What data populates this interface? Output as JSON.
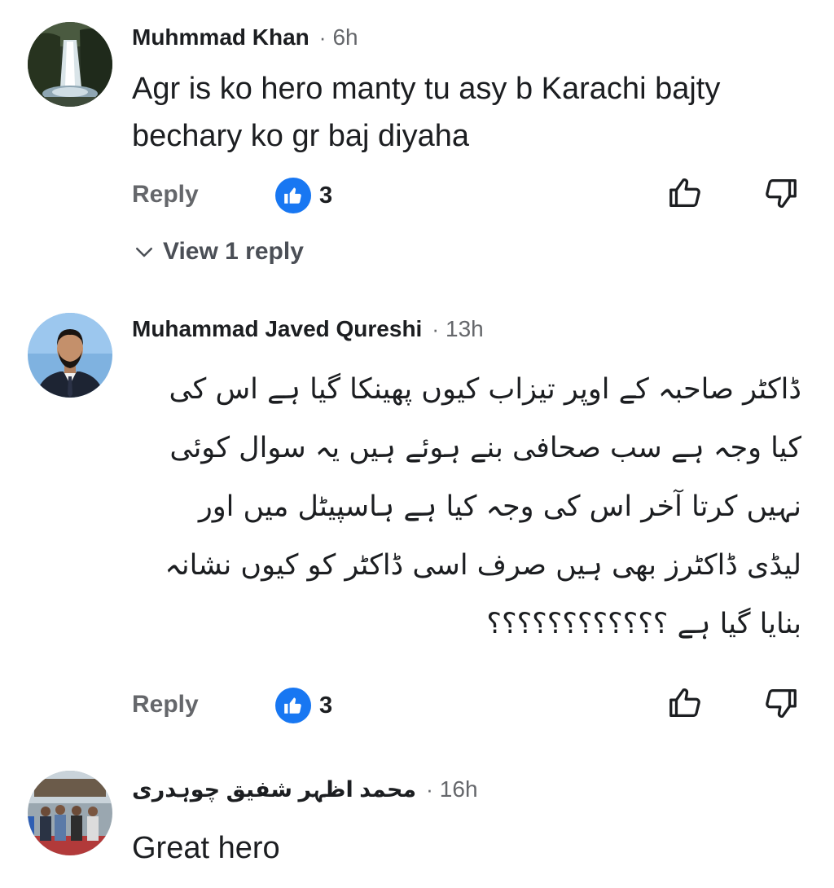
{
  "comments": [
    {
      "author": "Muhmmad Khan",
      "separator": "·",
      "time": "6h",
      "text_lines": [
        "Agr is ko hero manty tu asy b Karachi bajty",
        "bechary ko gr baj diyaha"
      ],
      "reply_label": "Reply",
      "like_count": "3",
      "view_replies_label": "View 1 reply",
      "avatar": "waterfall-photo"
    },
    {
      "author": "Muhammad Javed Qureshi",
      "separator": "·",
      "time": "13h",
      "text_lines": [
        "ڈاکٹر صاحبہ کے اوپر تیزاب کیوں پھینکا گیا ہے اس کی",
        "کیا وجہ ہے سب صحافی بنے ہوئے ہیں یہ سوال کوئی",
        "نہیں کرتا آخر اس کی وجہ کیا ہے ہاسپیٹل میں اور",
        "لیڈی ڈاکٹرز بھی ہیں صرف اسی ڈاکٹر کو کیوں نشانہ",
        "بنایا گیا ہے ؟؟؟؟؟؟؟؟؟؟؟؟"
      ],
      "reply_label": "Reply",
      "like_count": "3",
      "avatar": "man-portrait"
    },
    {
      "author": "محمد اظہر شفیق چوہدری",
      "separator": "·",
      "time": "16h",
      "text_lines": [
        "Great hero"
      ],
      "avatar": "group-photo"
    }
  ],
  "icons": {
    "like_badge": "thumbs-up-filled-icon",
    "like_button": "thumbs-up-outline-icon",
    "dislike_button": "thumbs-down-outline-icon",
    "view_replies": "chevron-down-icon"
  },
  "colors": {
    "accent": "#1877f2",
    "secondary_text": "#65676b",
    "primary_text": "#1c1e21"
  }
}
